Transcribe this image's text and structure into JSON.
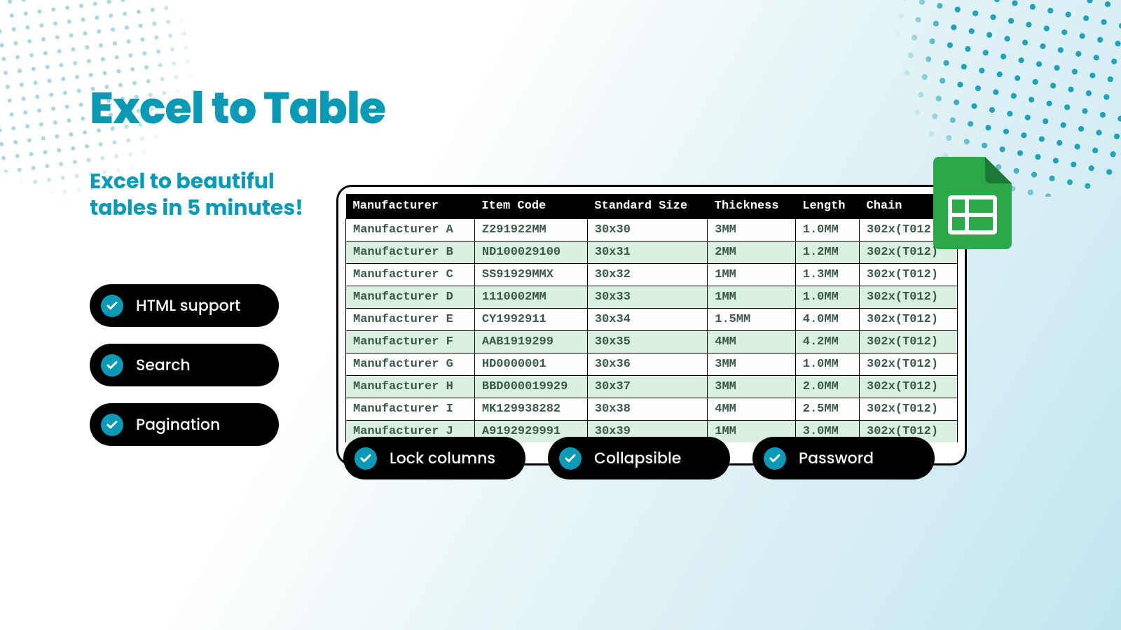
{
  "title": "Excel to Table",
  "subtitle": "Excel to beautiful tables in 5 minutes!",
  "left_features": [
    {
      "label": "HTML support"
    },
    {
      "label": "Search"
    },
    {
      "label": "Pagination"
    }
  ],
  "bottom_features": [
    {
      "label": "Lock columns"
    },
    {
      "label": "Collapsible"
    },
    {
      "label": "Password"
    }
  ],
  "table": {
    "headers": [
      "Manufacturer",
      "Item Code",
      "Standard Size",
      "Thickness",
      "Length",
      "Chain"
    ],
    "rows": [
      [
        "Manufacturer A",
        "Z291922MM",
        "30x30",
        "3MM",
        "1.0MM",
        "302x(T012)"
      ],
      [
        "Manufacturer B",
        "ND100029100",
        "30x31",
        "2MM",
        "1.2MM",
        "302x(T012)"
      ],
      [
        "Manufacturer C",
        "SS91929MMX",
        "30x32",
        "1MM",
        "1.3MM",
        "302x(T012)"
      ],
      [
        "Manufacturer D",
        "1110002MM",
        "30x33",
        "1MM",
        "1.0MM",
        "302x(T012)"
      ],
      [
        "Manufacturer E",
        "CY1992911",
        "30x34",
        "1.5MM",
        "4.0MM",
        "302x(T012)"
      ],
      [
        "Manufacturer F",
        "AAB1919299",
        "30x35",
        "4MM",
        "4.2MM",
        "302x(T012)"
      ],
      [
        "Manufacturer G",
        "HD0000001",
        "30x36",
        "3MM",
        "1.0MM",
        "302x(T012)"
      ],
      [
        "Manufacturer H",
        "BBD000019929",
        "30x37",
        "3MM",
        "2.0MM",
        "302x(T012)"
      ],
      [
        "Manufacturer I",
        "MK129938282",
        "30x38",
        "4MM",
        "2.5MM",
        "302x(T012)"
      ],
      [
        "Manufacturer J",
        "A9192929991",
        "30x39",
        "1MM",
        "3.0MM",
        "302x(T012)"
      ]
    ]
  },
  "colors": {
    "accent": "#0a9ab5",
    "pill_bg": "#000000",
    "row_alt": "#d9f0e1",
    "sheets_green": "#2aa84a"
  }
}
